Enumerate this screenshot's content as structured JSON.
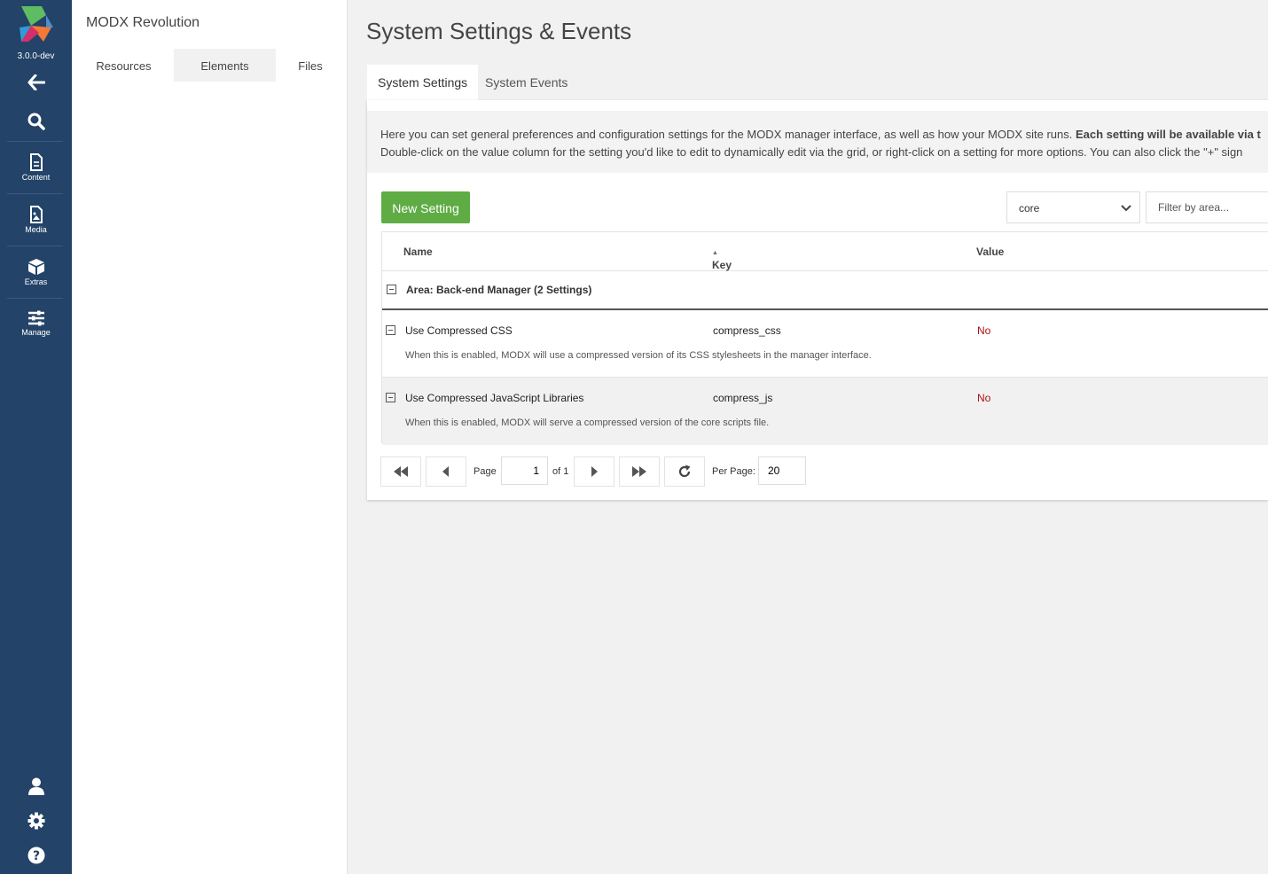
{
  "rail": {
    "version": "3.0.0-dev",
    "content_label": "Content",
    "media_label": "Media",
    "extras_label": "Extras",
    "manage_label": "Manage",
    "accent": "#234368"
  },
  "tree": {
    "site_name": "MODX Revolution",
    "tabs": [
      {
        "label": "Resources"
      },
      {
        "label": "Elements"
      },
      {
        "label": "Files"
      }
    ],
    "active_tab": "Elements"
  },
  "page": {
    "title": "System Settings & Events",
    "tabs": [
      {
        "label": "System Settings"
      },
      {
        "label": "System Events"
      }
    ],
    "active_tab": "System Settings",
    "description_line1": "Here you can set general preferences and configuration settings for the MODX manager interface, as well as how your MODX site runs. ",
    "description_line1_bold": "Each setting will be available via t",
    "description_line2": "Double-click on the value column for the setting you'd like to edit to dynamically edit via the grid, or right-click on a setting for more options. You can also click the \"+\" sign"
  },
  "toolbar": {
    "new_setting_label": "New Setting",
    "new_setting_color": "#5fac45",
    "namespace_value": "core",
    "filter_placeholder": "Filter by area..."
  },
  "grid": {
    "columns": {
      "name": "Name",
      "key": "Key",
      "value": "Value"
    },
    "sort_indicator": "▲",
    "group_label": "Area: Back-end Manager (2 Settings)",
    "rows": [
      {
        "name": "Use Compressed CSS",
        "key": "compress_css",
        "value": "No",
        "description": "When this is enabled, MODX will use a compressed version of its CSS stylesheets in the manager interface."
      },
      {
        "name": "Use Compressed JavaScript Libraries",
        "key": "compress_js",
        "value": "No",
        "description": "When this is enabled, MODX will serve a compressed version of the core scripts file."
      }
    ],
    "value_color": "#b40e0e"
  },
  "pagination": {
    "page_label": "Page",
    "page_value": "1",
    "of_label": "of 1",
    "per_page_label": "Per Page:",
    "per_page_value": "20"
  }
}
